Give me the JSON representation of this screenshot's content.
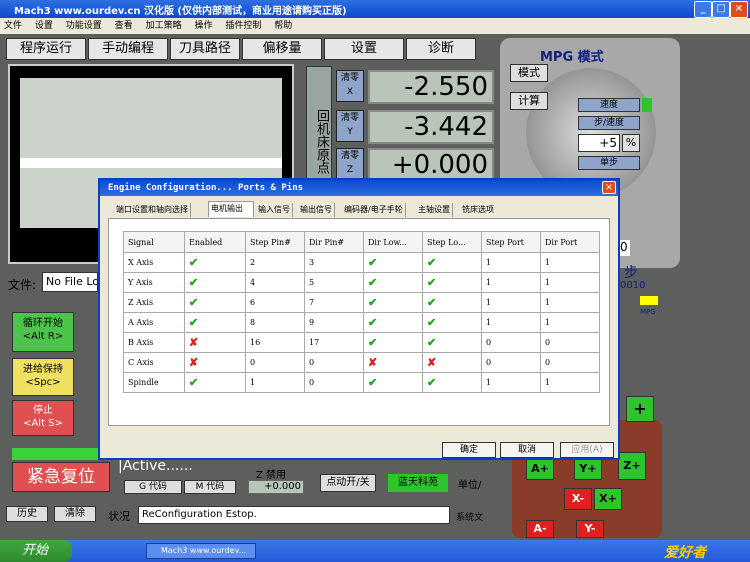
{
  "window": {
    "title": "Mach3 www.ourdev.cn 汉化版 (仅供内部测试，商业用途请购买正版)"
  },
  "menu": [
    "文件",
    "设置",
    "功能设置",
    "查看",
    "加工策略",
    "操作",
    "插件控制",
    "帮助"
  ],
  "tabs": [
    "程序运行",
    "手动编程",
    "刀具路径",
    "偏移量",
    "设置",
    "诊断"
  ],
  "dro": {
    "zero_label": "清零",
    "axes": [
      {
        "axis": "X",
        "value": "-2.550"
      },
      {
        "axis": "Y",
        "value": "-3.442"
      },
      {
        "axis": "Z",
        "value": "+0.000"
      }
    ],
    "side_label": "回机床原点"
  },
  "mpg": {
    "title": "MPG 模式",
    "mode_btn": "模式",
    "calc_btn": "计算",
    "speed_btn": "速度",
    "step_speed_btn": "步/速度",
    "percent_value": "+5",
    "percent_unit": "%",
    "single_step_btn": "单步",
    "step_label": "步",
    "step_value": "0010",
    "mpg_small": "MPG"
  },
  "file": {
    "label": "文件:",
    "value": "No File Lo"
  },
  "buttons": {
    "cycle_start": "循环开始\n<Alt R>",
    "feed_hold": "进给保持\n<Spc>",
    "stop": "停止\n<Alt S>",
    "reset": "紧急复位",
    "history": "历史",
    "clear": "清除",
    "gcode": "G 代码",
    "mcode": "M 代码",
    "jog": "点动开/关",
    "brand": "蓝天科苑"
  },
  "status": {
    "active_text": "|Active......",
    "z_forbid": "Z 禁用",
    "z_value": "+0.000",
    "unit_label": "单位/",
    "status_label": "状况",
    "status_value": "ReConfiguration Estop.",
    "system_label": "系统文"
  },
  "jog_keys": [
    "A+",
    "Y+",
    "Z+",
    "X-",
    "X+",
    "A-",
    "Y-"
  ],
  "dialog": {
    "title": "Engine Configuration... Ports & Pins",
    "tabs": [
      "端口设置和轴向选择",
      "电机输出",
      "输入信号",
      "输出信号",
      "编码器/电子手轮",
      "主轴设置",
      "铣床选项"
    ],
    "active_tab": 1,
    "columns": [
      "Signal",
      "Enabled",
      "Step Pin#",
      "Dir Pin#",
      "Dir Low...",
      "Step Lo...",
      "Step Port",
      "Dir Port"
    ],
    "rows": [
      {
        "signal": "X Axis",
        "enabled": true,
        "step_pin": "2",
        "dir_pin": "3",
        "dir_low": true,
        "step_low": true,
        "step_port": "1",
        "dir_port": "1"
      },
      {
        "signal": "Y Axis",
        "enabled": true,
        "step_pin": "4",
        "dir_pin": "5",
        "dir_low": true,
        "step_low": true,
        "step_port": "1",
        "dir_port": "1"
      },
      {
        "signal": "Z Axis",
        "enabled": true,
        "step_pin": "6",
        "dir_pin": "7",
        "dir_low": true,
        "step_low": true,
        "step_port": "1",
        "dir_port": "1"
      },
      {
        "signal": "A Axis",
        "enabled": true,
        "step_pin": "8",
        "dir_pin": "9",
        "dir_low": true,
        "step_low": true,
        "step_port": "1",
        "dir_port": "1"
      },
      {
        "signal": "B Axis",
        "enabled": false,
        "step_pin": "16",
        "dir_pin": "17",
        "dir_low": true,
        "step_low": true,
        "step_port": "0",
        "dir_port": "0"
      },
      {
        "signal": "C Axis",
        "enabled": false,
        "step_pin": "0",
        "dir_pin": "0",
        "dir_low": false,
        "step_low": false,
        "step_port": "0",
        "dir_port": "0"
      },
      {
        "signal": "Spindle",
        "enabled": true,
        "step_pin": "1",
        "dir_pin": "0",
        "dir_low": true,
        "step_low": true,
        "step_port": "1",
        "dir_port": "1"
      }
    ],
    "ok": "确定",
    "cancel": "取消",
    "apply": "应用(A)"
  },
  "taskbar": {
    "start": "开始",
    "item": "Mach3 www.ourdev...",
    "logo": "爱好者"
  }
}
